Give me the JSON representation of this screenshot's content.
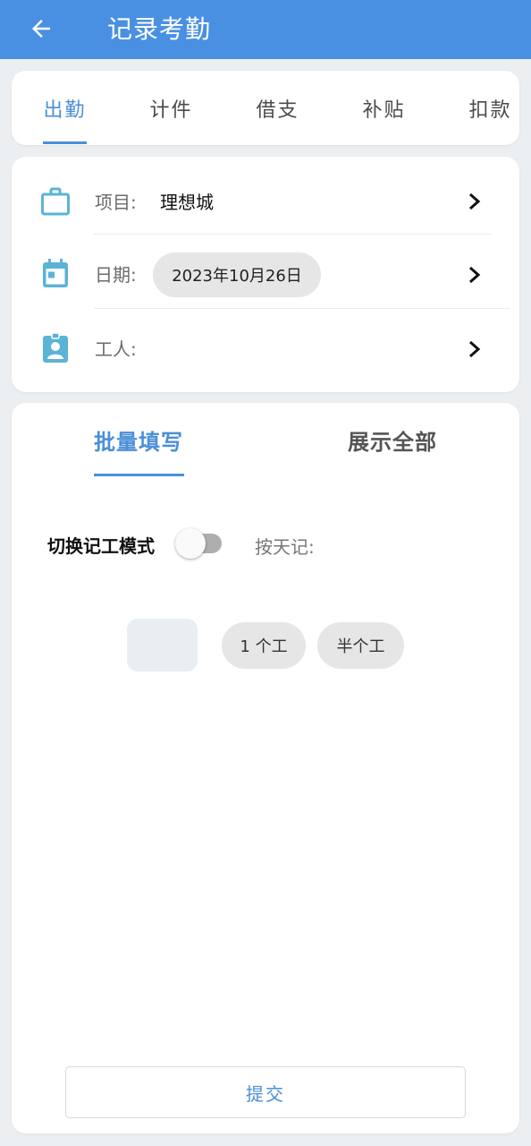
{
  "app_bar": {
    "title": "记录考勤"
  },
  "tabs": [
    {
      "label": "出勤",
      "active": true
    },
    {
      "label": "计件",
      "active": false
    },
    {
      "label": "借支",
      "active": false
    },
    {
      "label": "补贴",
      "active": false
    },
    {
      "label": "扣款",
      "active": false
    }
  ],
  "info": {
    "project": {
      "label": "项目:",
      "value": "理想城"
    },
    "date": {
      "label": "日期:",
      "value": "2023年10月26日"
    },
    "worker": {
      "label": "工人:",
      "value": ""
    }
  },
  "sub_tabs": [
    {
      "label": "批量填写",
      "active": true
    },
    {
      "label": "展示全部",
      "active": false
    }
  ],
  "mode": {
    "label": "切换记工模式",
    "enabled": false,
    "by_day_label": "按天记:"
  },
  "quick_values": [
    "1 个工",
    "半个工"
  ],
  "submit_label": "提交",
  "colors": {
    "primary": "#4a90e2",
    "accent": "#4a8fd8",
    "icon": "#5bb3d6"
  }
}
